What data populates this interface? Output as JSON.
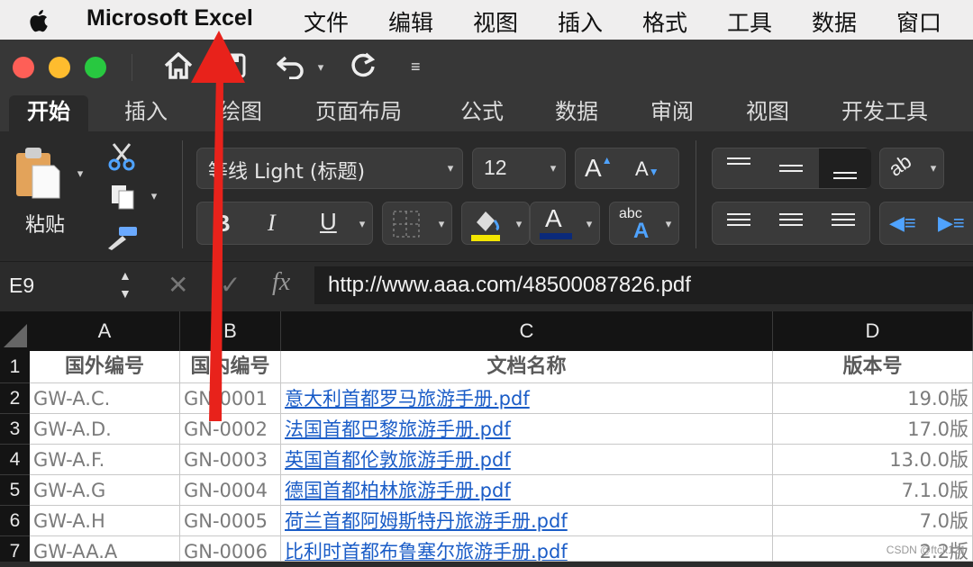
{
  "menubar": {
    "app_name": "Microsoft Excel",
    "items": [
      "文件",
      "编辑",
      "视图",
      "插入",
      "格式",
      "工具",
      "数据",
      "窗口"
    ]
  },
  "ribbon": {
    "tabs": [
      "开始",
      "插入",
      "绘图",
      "页面布局",
      "公式",
      "数据",
      "审阅",
      "视图",
      "开发工具"
    ],
    "paste_label": "粘贴",
    "font_name": "等线 Light (标题)",
    "font_size": "12",
    "bold": "B",
    "italic": "I",
    "underline": "U",
    "font_color_glyph": "A",
    "abc_label": "abc"
  },
  "formula_bar": {
    "cell_ref": "E9",
    "fx_label": "fx",
    "value": "http://www.aaa.com/48500087826.pdf"
  },
  "sheet": {
    "columns": [
      "A",
      "B",
      "C",
      "D"
    ],
    "rows": [
      {
        "num": "1",
        "a": "国外编号",
        "b": "国内编号",
        "c": "文档名称",
        "d": "版本号"
      },
      {
        "num": "2",
        "a": "GW-A.C.",
        "b": "GN-0001",
        "c": "意大利首都罗马旅游手册.pdf",
        "d": "19.0版"
      },
      {
        "num": "3",
        "a": "GW-A.D.",
        "b": "GN-0002",
        "c": "法国首都巴黎旅游手册.pdf",
        "d": "17.0版"
      },
      {
        "num": "4",
        "a": "GW-A.F.",
        "b": "GN-0003",
        "c": "英国首都伦敦旅游手册.pdf",
        "d": "13.0.0版"
      },
      {
        "num": "5",
        "a": "GW-A.G",
        "b": "GN-0004",
        "c": "德国首都柏林旅游手册.pdf",
        "d": "7.1.0版"
      },
      {
        "num": "6",
        "a": "GW-A.H",
        "b": "GN-0005",
        "c": "荷兰首都阿姆斯特丹旅游手册.pdf",
        "d": "7.0版"
      },
      {
        "num": "7",
        "a": "GW-AA.A",
        "b": "GN-0006",
        "c": "比利时首都布鲁塞尔旅游手册.pdf",
        "d": "2.2版"
      }
    ]
  },
  "watermark": "CSDN @ftck121",
  "colors": {
    "highlight": "#f3e600",
    "font_color": "#0b2a7a",
    "annotation_arrow": "#e8221b",
    "link": "#1a5cc7"
  }
}
